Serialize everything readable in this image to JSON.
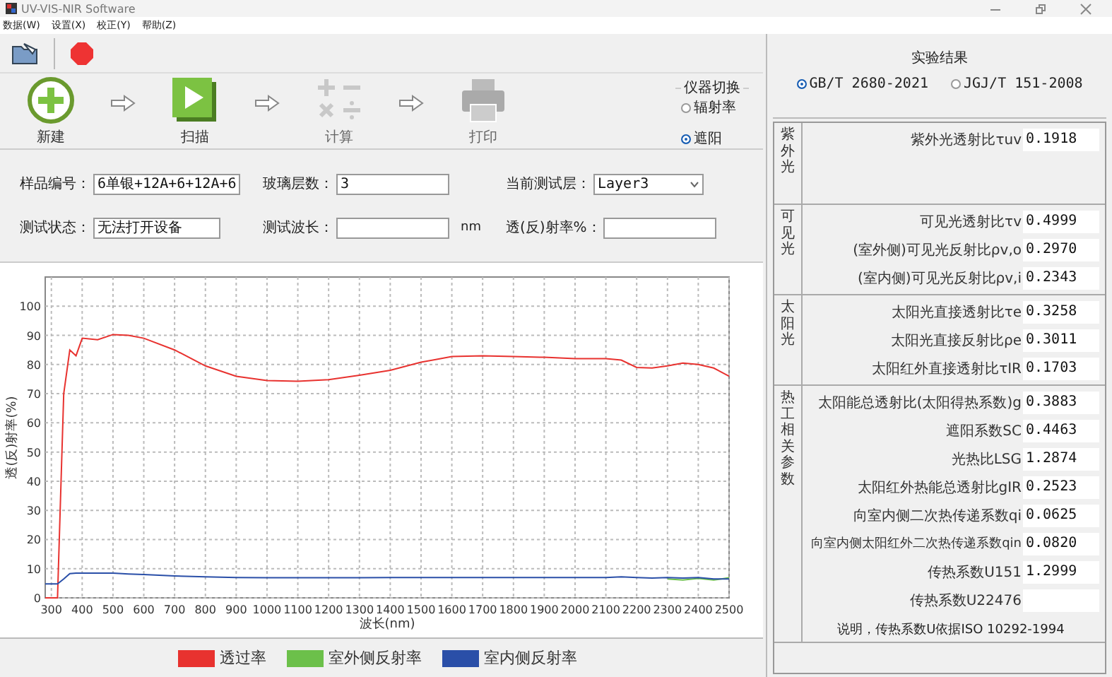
{
  "window": {
    "title": "UV-VIS-NIR Software"
  },
  "menu": [
    "数据(W)",
    "设置(X)",
    "校正(Y)",
    "帮助(Z)"
  ],
  "steps": [
    {
      "kind": "new",
      "label": "新建",
      "disabled": false
    },
    {
      "kind": "scan",
      "label": "扫描",
      "disabled": false
    },
    {
      "kind": "calc",
      "label": "计算",
      "disabled": true
    },
    {
      "kind": "print",
      "label": "打印",
      "disabled": true
    }
  ],
  "instrument_switch": {
    "title": "仪器切换",
    "options": [
      {
        "label": "辐射率",
        "selected": false
      },
      {
        "label": "遮阳",
        "selected": true
      }
    ]
  },
  "form": [
    {
      "kind": "text",
      "label": "样品编号：",
      "value": "6单银+12A+6+12A+6"
    },
    {
      "kind": "text",
      "label": "玻璃层数：",
      "value": "3"
    },
    {
      "kind": "select",
      "label": "当前测试层：",
      "value": "Layer3"
    },
    {
      "kind": "text",
      "label": "测试状态：",
      "value": "无法打开设备"
    },
    {
      "kind": "text",
      "label": "测试波长：",
      "unit": "nm"
    },
    {
      "kind": "text",
      "label": "透(反)射率%："
    }
  ],
  "chart": {
    "chart_data": {
      "type": "line",
      "xlabel": "波长(nm)",
      "ylabel": "透(反)射率(%)",
      "x": [
        280,
        300,
        320,
        340,
        360,
        380,
        400,
        450,
        500,
        550,
        600,
        700,
        800,
        900,
        1000,
        1100,
        1200,
        1300,
        1400,
        1500,
        1600,
        1700,
        1800,
        1900,
        2000,
        2100,
        2150,
        2200,
        2250,
        2300,
        2350,
        2400,
        2450,
        2500
      ],
      "series": [
        {
          "name": "透过率",
          "color": "#e8322f",
          "values": [
            0,
            0,
            0,
            70,
            85,
            83,
            89,
            88.5,
            90.3,
            90,
            89,
            85,
            79.5,
            76,
            74.5,
            74.3,
            74.8,
            76.3,
            78,
            80.8,
            82.7,
            83,
            82.7,
            82.5,
            82,
            82,
            81.5,
            79,
            78.8,
            79.5,
            80.5,
            80,
            78.8,
            76
          ]
        },
        {
          "name": "室外侧反射率",
          "color": "#6cc04a",
          "values": [
            null,
            null,
            null,
            null,
            null,
            null,
            null,
            null,
            null,
            null,
            null,
            null,
            null,
            null,
            null,
            null,
            null,
            null,
            null,
            null,
            null,
            null,
            null,
            null,
            null,
            null,
            null,
            null,
            null,
            6.5,
            6.1,
            6.7,
            6.1,
            6.9
          ]
        },
        {
          "name": "室内侧反射率",
          "color": "#2a4fa8",
          "values": [
            4.8,
            4.8,
            4.8,
            6.5,
            8.3,
            8.5,
            8.5,
            8.5,
            8.5,
            8.2,
            8,
            7.5,
            7.2,
            7,
            6.9,
            6.9,
            6.9,
            6.9,
            7,
            7,
            7,
            7,
            7,
            7,
            7,
            7,
            7.2,
            7,
            6.8,
            7,
            6.8,
            7,
            6.5,
            6.5
          ]
        }
      ],
      "xlim": [
        280,
        2500
      ],
      "ylim": [
        0,
        110
      ],
      "grid": true,
      "xticks": [
        300,
        400,
        500,
        600,
        700,
        800,
        900,
        1000,
        1100,
        1200,
        1300,
        1400,
        1500,
        1600,
        1700,
        1800,
        1900,
        2000,
        2100,
        2200,
        2300,
        2400,
        2500
      ],
      "yticks": [
        0,
        10,
        20,
        30,
        40,
        50,
        60,
        70,
        80,
        90,
        100
      ]
    }
  },
  "results": {
    "title": "实验结果",
    "standards": [
      {
        "label": "GB/T 2680-2021",
        "selected": true
      },
      {
        "label": "JGJ/T 151-2008",
        "selected": false
      }
    ],
    "groups": [
      {
        "label": "紫外光",
        "rows": [
          {
            "label": "紫外光透射比τuv",
            "value": "0.1918"
          }
        ]
      },
      {
        "label": "可见光",
        "rows": [
          {
            "label": "可见光透射比τv",
            "value": "0.4999"
          },
          {
            "label": "(室外侧)可见光反射比ρv,o",
            "value": "0.2970"
          },
          {
            "label": "(室内侧)可见光反射比ρv,i",
            "value": "0.2343"
          }
        ]
      },
      {
        "label": "太阳光",
        "rows": [
          {
            "label": "太阳光直接透射比τe",
            "value": "0.3258"
          },
          {
            "label": "太阳光直接反射比ρe",
            "value": "0.3011"
          },
          {
            "label": "太阳红外直接透射比τIR",
            "value": "0.1703"
          }
        ]
      },
      {
        "label": "热工相关参数",
        "rows": [
          {
            "label": "太阳能总透射比(太阳得热系数)g",
            "value": "0.3883"
          },
          {
            "label": "遮阳系数SC",
            "value": "0.4463"
          },
          {
            "label": "光热比LSG",
            "value": "1.2874"
          },
          {
            "label": "太阳红外热能总透射比gIR",
            "value": "0.2523"
          },
          {
            "label": "向室内侧二次热传递系数qi",
            "value": "0.0625"
          },
          {
            "label": "向室内侧太阳红外二次热传递系数qin",
            "value": "0.0820"
          },
          {
            "label": "传热系数U151",
            "value": "1.2999"
          },
          {
            "label": "传热系数U22476"
          }
        ],
        "note": "说明，传热系数U依据ISO 10292-1994"
      }
    ]
  }
}
